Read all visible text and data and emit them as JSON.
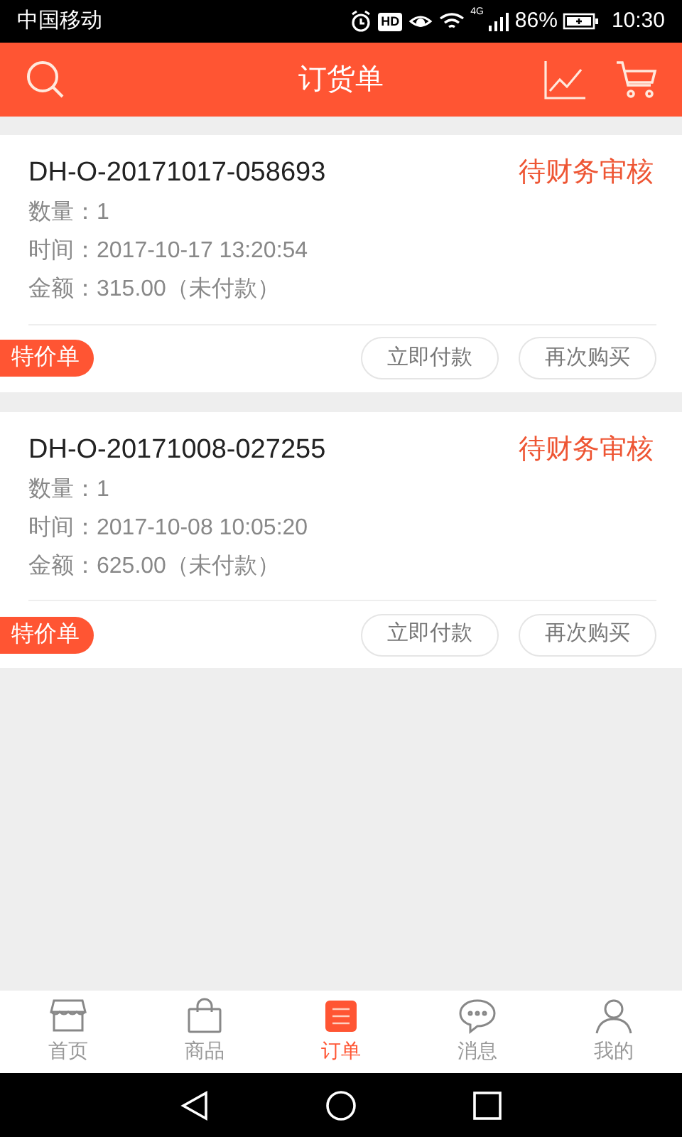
{
  "status_bar": {
    "carrier": "中国移动",
    "hd": "HD",
    "network": "4G",
    "battery": "86%",
    "time": "10:30"
  },
  "header": {
    "title": "订货单"
  },
  "orders": [
    {
      "number": "DH-O-20171017-058693",
      "status": "待财务审核",
      "quantity_label": "数量：",
      "quantity": "1",
      "time_label": "时间：",
      "time": "2017-10-17 13:20:54",
      "amount_label": "金额：",
      "amount": "315.00（未付款）",
      "tag": "特价单",
      "actions": [
        "立即付款",
        "再次购买"
      ]
    },
    {
      "number": "DH-O-20171008-027255",
      "status": "待财务审核",
      "quantity_label": "数量：",
      "quantity": "1",
      "time_label": "时间：",
      "time": "2017-10-08 10:05:20",
      "amount_label": "金额：",
      "amount": "625.00（未付款）",
      "tag": "特价单",
      "actions": [
        "立即付款",
        "再次购买"
      ]
    }
  ],
  "bottom_nav": [
    {
      "kind": "store",
      "label": "首页",
      "selected": false
    },
    {
      "kind": "bag",
      "label": "商品",
      "selected": false
    },
    {
      "kind": "orders",
      "label": "订单",
      "selected": true
    },
    {
      "kind": "chat",
      "label": "消息",
      "selected": false
    },
    {
      "kind": "person",
      "label": "我的",
      "selected": false
    }
  ]
}
